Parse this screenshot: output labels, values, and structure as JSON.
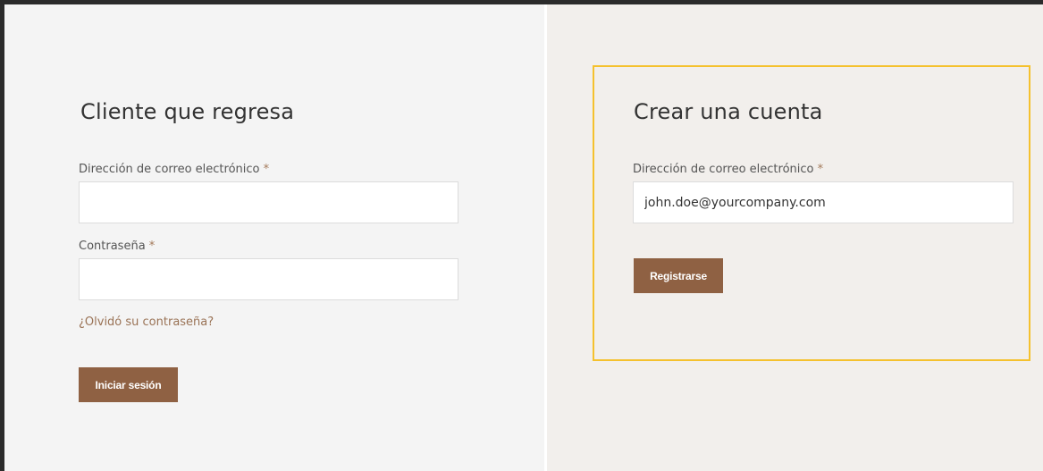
{
  "login": {
    "heading": "Cliente que regresa",
    "email_label": "Dirección de correo electrónico",
    "email_value": "",
    "password_label": "Contraseña",
    "password_value": "",
    "required_marker": "*",
    "forgot_link": "¿Olvidó su contraseña?",
    "submit_label": "Iniciar sesión"
  },
  "register": {
    "heading": "Crear una cuenta",
    "email_label": "Dirección de correo electrónico",
    "email_value": "john.doe@yourcompany.com",
    "required_marker": "*",
    "submit_label": "Registrarse"
  },
  "colors": {
    "accent_button": "#8f6143",
    "link": "#9a7356",
    "highlight_border": "#f5c12e",
    "left_background": "#f4f4f4",
    "right_background": "#f2efec"
  }
}
